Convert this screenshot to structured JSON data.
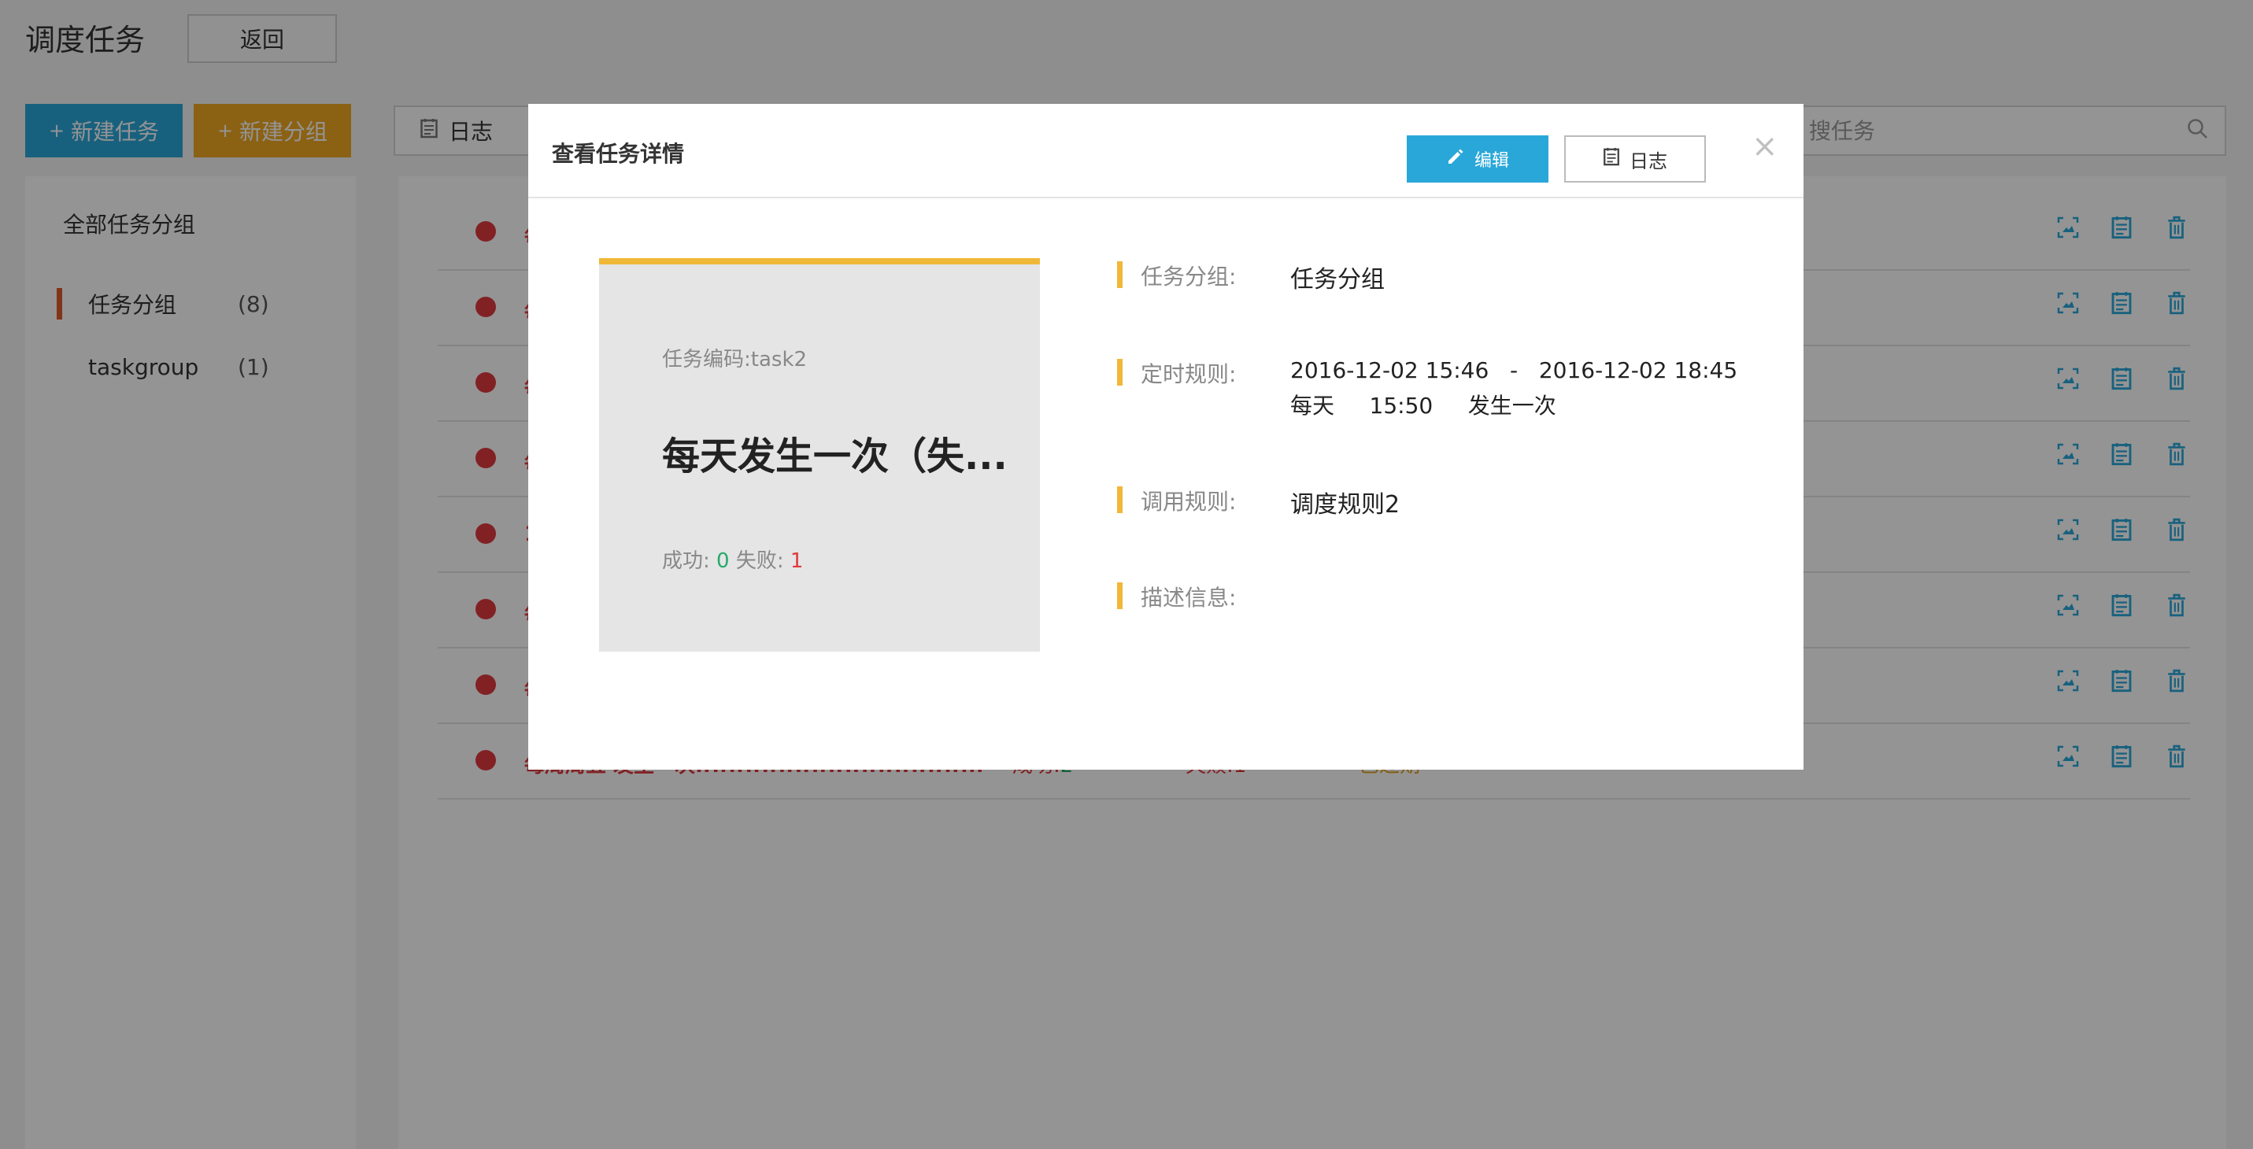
{
  "page": {
    "title": "调度任务",
    "back_label": "返回"
  },
  "toolbar": {
    "new_task_label": "新建任务",
    "new_group_label": "新建分组",
    "log_label": "日志",
    "search_placeholder": "搜任务"
  },
  "sidebar": {
    "title": "全部任务分组",
    "groups": [
      {
        "label": "任务分组",
        "count": "(8)",
        "active": true
      },
      {
        "label": "taskgroup",
        "count": "(1)",
        "active": false
      }
    ]
  },
  "task_list": {
    "rows": [
      {
        "name": "每",
        "success_label": "",
        "success": "",
        "fail_label": "",
        "fail": "",
        "status": ""
      },
      {
        "name": "每",
        "success_label": "",
        "success": "",
        "fail_label": "",
        "fail": "",
        "status": ""
      },
      {
        "name": "每",
        "success_label": "",
        "success": "",
        "fail_label": "",
        "fail": "",
        "status": ""
      },
      {
        "name": "每",
        "success_label": "",
        "success": "",
        "fail_label": "",
        "fail": "",
        "status": ""
      },
      {
        "name": "1",
        "success_label": "",
        "success": "",
        "fail_label": "",
        "fail": "",
        "status": ""
      },
      {
        "name": "每",
        "success_label": "",
        "success": "",
        "fail_label": "",
        "fail": "",
        "status": ""
      },
      {
        "name": "每",
        "success_label": "",
        "success": "",
        "fail_label": "",
        "fail": "",
        "status": ""
      },
      {
        "name": "每周周五 发生一次ffffffffffffffffffffffffffffffff...",
        "success_label": "成功:",
        "success": "2",
        "fail_label": "失败:",
        "fail": "1",
        "status": "已过期"
      }
    ]
  },
  "modal": {
    "title": "查看任务详情",
    "edit_label": "编辑",
    "log_label": "日志",
    "close_glyph": "×",
    "card": {
      "code_label": "任务编码:",
      "code_value": "task2",
      "title": "每天发生一次（失...",
      "success_label": "成功:",
      "success_value": "0",
      "fail_label": "失败:",
      "fail_value": "1"
    },
    "details": {
      "group_label": "任务分组:",
      "group_value": "任务分组",
      "schedule_label": "定时规则:",
      "schedule_range": "2016-12-02 15:46   -   2016-12-02 18:45",
      "schedule_freq": "每天     15:50     发生一次",
      "call_label": "调用规则:",
      "call_value": "调度规则2",
      "desc_label": "描述信息:",
      "desc_value": ""
    }
  },
  "colors": {
    "accent_blue": "#2aa7d9",
    "accent_orange": "#f0a821",
    "danger_red": "#e0393e",
    "success_green": "#27a96b",
    "card_yellow": "#f0b838"
  }
}
